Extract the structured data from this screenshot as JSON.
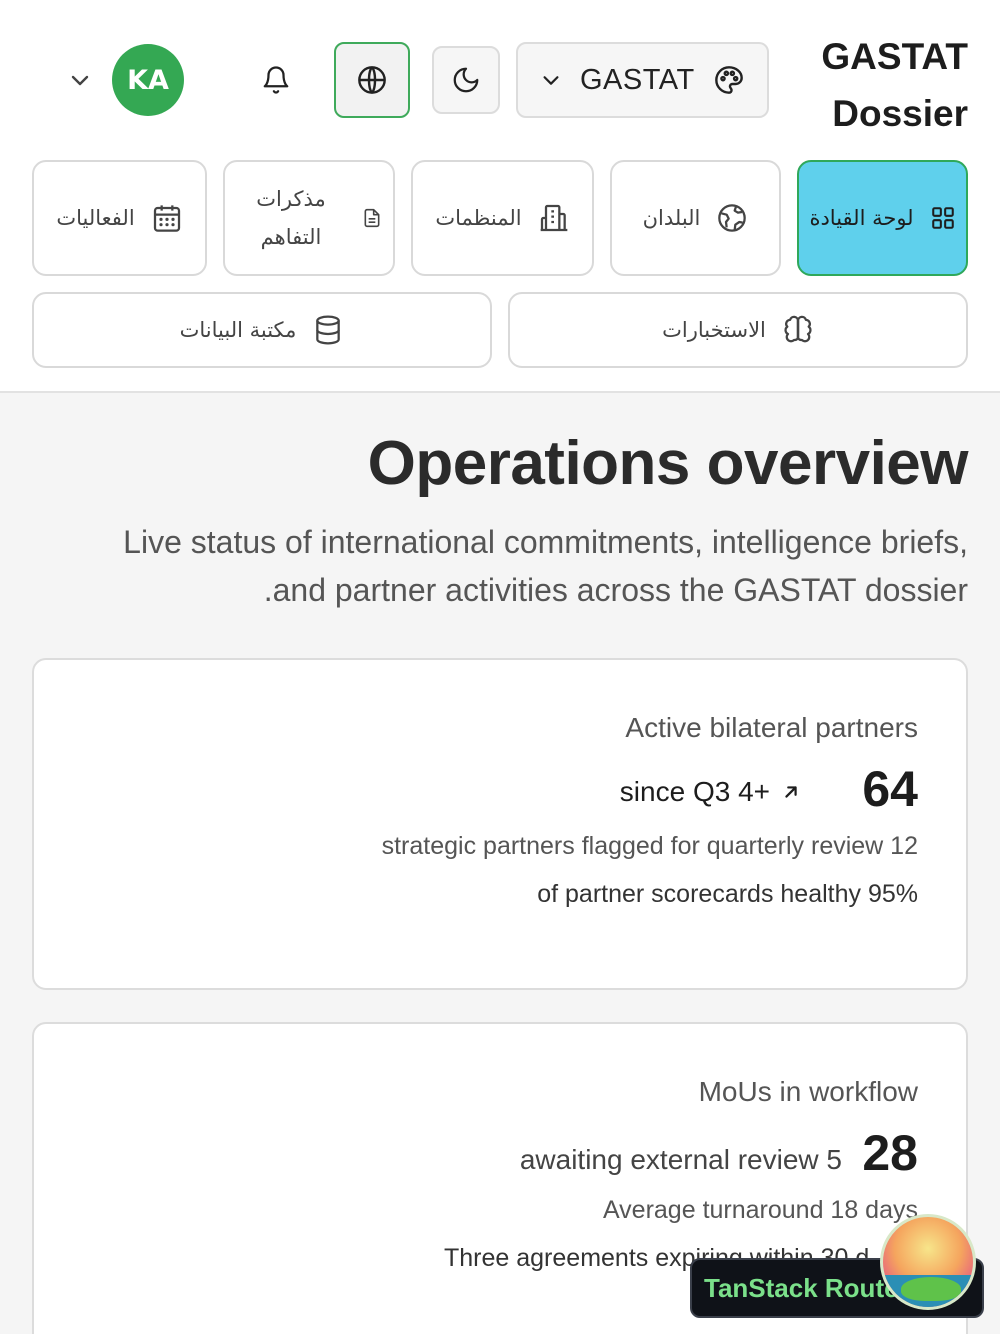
{
  "header": {
    "brand_line1": "GASTAT",
    "brand_line2": "Dossier",
    "org_selector_label": "GASTAT",
    "avatar_initials": "KA"
  },
  "nav": {
    "items": [
      {
        "label": "لوحة القيادة",
        "icon": "dashboard-grid-icon",
        "active": true
      },
      {
        "label": "البلدان",
        "icon": "earth-icon",
        "active": false
      },
      {
        "label": "المنظمات",
        "icon": "building-icon",
        "active": false
      },
      {
        "label": "مذكرات التفاهم",
        "icon": "document-icon",
        "active": false
      },
      {
        "label": "الفعاليات",
        "icon": "calendar-icon",
        "active": false
      },
      {
        "label": "الاستخبارات",
        "icon": "brain-icon",
        "active": false
      },
      {
        "label": "مكتبة البيانات",
        "icon": "database-icon",
        "active": false
      }
    ]
  },
  "main": {
    "title": "Operations overview",
    "subtitle_line1": "Live status of international commitments, intelligence briefs,",
    "subtitle_line2": ".and partner activities across the GASTAT dossier"
  },
  "cards": [
    {
      "title": "Active bilateral partners",
      "value": "64",
      "delta": "since Q3 4+",
      "line1": "strategic partners flagged for quarterly review 12",
      "line2": "of partner scorecards healthy 95%"
    },
    {
      "title": "MoUs in workflow",
      "value": "28",
      "delta": "awaiting external review 5",
      "line1": "Average turnaround 18 days",
      "line2": "Three agreements expiring within 30 d"
    }
  ],
  "devtools": {
    "label": "TanStack Router"
  },
  "colors": {
    "accent_green": "#34a853",
    "active_nav_bg": "#5fd0ec",
    "active_border": "#2fa85a"
  }
}
